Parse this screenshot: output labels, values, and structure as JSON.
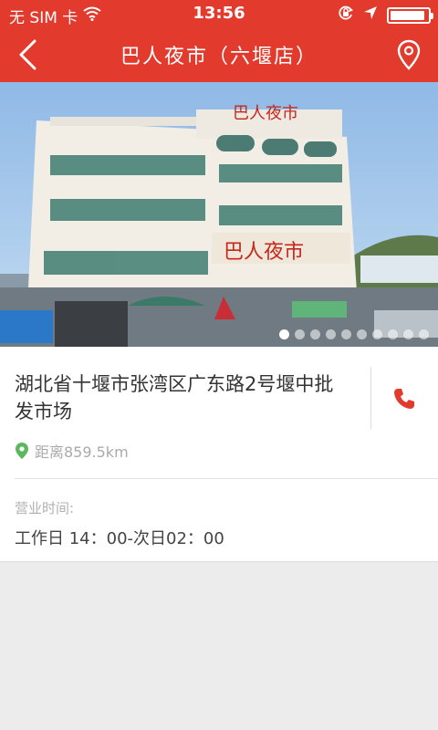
{
  "status_bar": {
    "carrier": "无 SIM 卡",
    "time": "13:56",
    "battery_level": 0.92
  },
  "nav": {
    "title": "巴人夜市（六堰店）"
  },
  "hero": {
    "sign_text": "巴人夜市",
    "slide_count": 10,
    "active_slide": 0
  },
  "store": {
    "address": "湖北省十堰市张湾区广东路2号堰中批发市场",
    "distance": "距离859.5km",
    "hours_label": "营业时间:",
    "hours_value": "工作日 14：00-次日02：00"
  },
  "colors": {
    "brand_red": "#e23a2c",
    "location_green": "#5cb85c",
    "phone_red": "#e23a2c"
  }
}
